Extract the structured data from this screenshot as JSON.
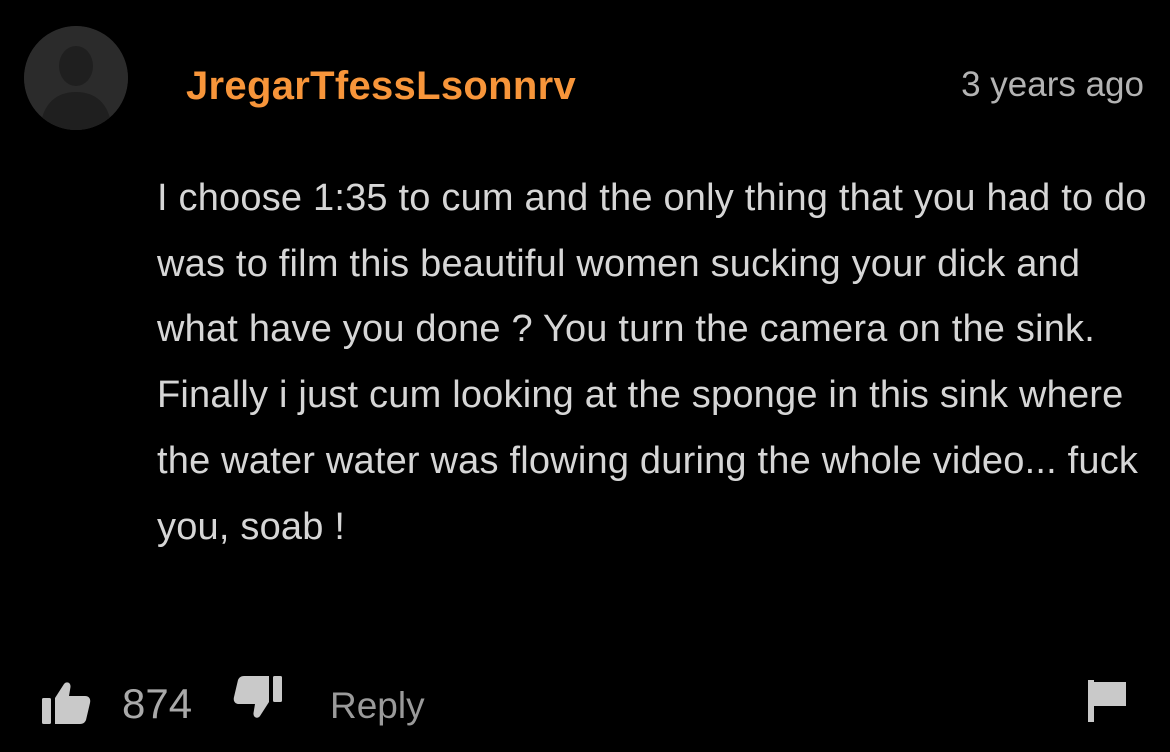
{
  "comment": {
    "username": "JregarTfessLsonnrv",
    "timestamp": "3 years ago",
    "body": "I choose 1:35 to cum and the only thing that you had to do was to film this beautiful women sucking your dick and what have you done ? You turn the camera on the sink. Finally i just cum looking at the sponge in this sink where the water water was flowing during the whole video... fuck you, soab !",
    "votes": "874",
    "reply_label": "Reply"
  },
  "icons": {
    "avatar": "default-user-avatar",
    "upvote": "thumbs-up-icon",
    "downvote": "thumbs-down-icon",
    "report": "flag-icon"
  },
  "colors": {
    "background": "#000000",
    "username": "#f7953a",
    "body_text": "#d6d6d6",
    "muted_text": "#a9a9a9",
    "avatar_bg": "#2b2b2b"
  }
}
